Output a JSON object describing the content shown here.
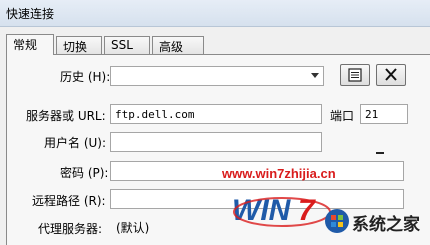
{
  "window": {
    "title": "快速连接"
  },
  "tabs": [
    {
      "label": "常规",
      "active": true
    },
    {
      "label": "切换",
      "active": false
    },
    {
      "label": "SSL",
      "active": false
    },
    {
      "label": "高级",
      "active": false
    }
  ],
  "form": {
    "history_label": "历史 (H):",
    "history_value": "",
    "history_buttons": [
      {
        "icon": "properties-icon"
      },
      {
        "icon": "close-icon"
      }
    ],
    "server_label": "服务器或 URL:",
    "server_value": "ftp.dell.com",
    "port_label": "端口",
    "port_value": "21",
    "username_label": "用户名 (U):",
    "username_value": "",
    "password_label": "密码 (P):",
    "password_value": "",
    "remote_path_label": "远程路径 (R):",
    "remote_path_value": "",
    "proxy_label": "代理服务器:",
    "proxy_value": "(默认)"
  },
  "watermark": {
    "site": "www.win7zhijia.cn",
    "brand": "系统之家",
    "colors": {
      "red": "#d91c1c",
      "blue": "#1f5aa8",
      "dark": "#222222"
    }
  }
}
